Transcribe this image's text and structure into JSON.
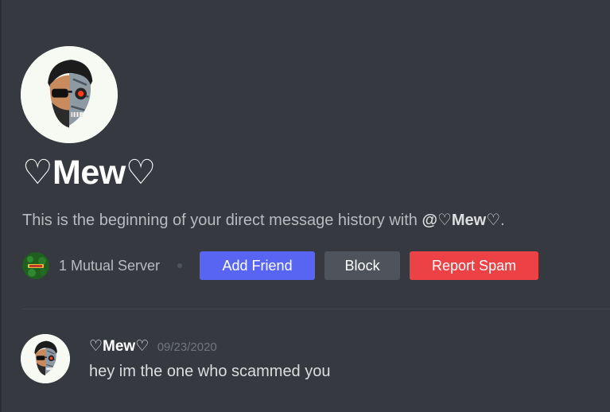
{
  "profile": {
    "username": "♡Mew♡",
    "history_prefix": "This is the beginning of your direct message history with ",
    "mention": "@♡Mew♡",
    "history_suffix": ".",
    "mutual_servers": "1 Mutual Server"
  },
  "actions": {
    "add_friend": "Add Friend",
    "block": "Block",
    "report_spam": "Report Spam"
  },
  "colors": {
    "background": "#36393f",
    "add_friend": "#5865f2",
    "block": "#4f545c",
    "report_spam": "#ed4245"
  },
  "messages": [
    {
      "author": "♡Mew♡",
      "timestamp": "09/23/2020",
      "text": "hey im the one who scammed you"
    }
  ],
  "icons": {
    "profile_avatar": "avatar-icon",
    "server": "server-icon"
  }
}
